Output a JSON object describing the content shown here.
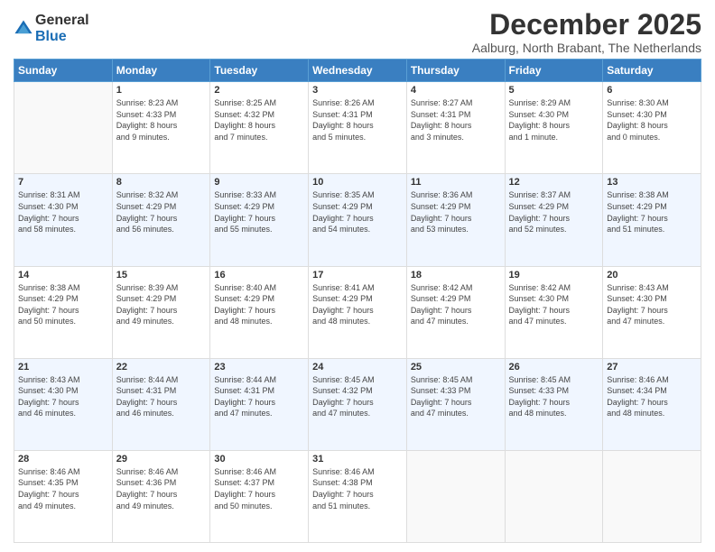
{
  "header": {
    "logo_general": "General",
    "logo_blue": "Blue",
    "month_title": "December 2025",
    "location": "Aalburg, North Brabant, The Netherlands"
  },
  "days_of_week": [
    "Sunday",
    "Monday",
    "Tuesday",
    "Wednesday",
    "Thursday",
    "Friday",
    "Saturday"
  ],
  "weeks": [
    [
      {
        "day": "",
        "info": ""
      },
      {
        "day": "1",
        "info": "Sunrise: 8:23 AM\nSunset: 4:33 PM\nDaylight: 8 hours\nand 9 minutes."
      },
      {
        "day": "2",
        "info": "Sunrise: 8:25 AM\nSunset: 4:32 PM\nDaylight: 8 hours\nand 7 minutes."
      },
      {
        "day": "3",
        "info": "Sunrise: 8:26 AM\nSunset: 4:31 PM\nDaylight: 8 hours\nand 5 minutes."
      },
      {
        "day": "4",
        "info": "Sunrise: 8:27 AM\nSunset: 4:31 PM\nDaylight: 8 hours\nand 3 minutes."
      },
      {
        "day": "5",
        "info": "Sunrise: 8:29 AM\nSunset: 4:30 PM\nDaylight: 8 hours\nand 1 minute."
      },
      {
        "day": "6",
        "info": "Sunrise: 8:30 AM\nSunset: 4:30 PM\nDaylight: 8 hours\nand 0 minutes."
      }
    ],
    [
      {
        "day": "7",
        "info": "Sunrise: 8:31 AM\nSunset: 4:30 PM\nDaylight: 7 hours\nand 58 minutes."
      },
      {
        "day": "8",
        "info": "Sunrise: 8:32 AM\nSunset: 4:29 PM\nDaylight: 7 hours\nand 56 minutes."
      },
      {
        "day": "9",
        "info": "Sunrise: 8:33 AM\nSunset: 4:29 PM\nDaylight: 7 hours\nand 55 minutes."
      },
      {
        "day": "10",
        "info": "Sunrise: 8:35 AM\nSunset: 4:29 PM\nDaylight: 7 hours\nand 54 minutes."
      },
      {
        "day": "11",
        "info": "Sunrise: 8:36 AM\nSunset: 4:29 PM\nDaylight: 7 hours\nand 53 minutes."
      },
      {
        "day": "12",
        "info": "Sunrise: 8:37 AM\nSunset: 4:29 PM\nDaylight: 7 hours\nand 52 minutes."
      },
      {
        "day": "13",
        "info": "Sunrise: 8:38 AM\nSunset: 4:29 PM\nDaylight: 7 hours\nand 51 minutes."
      }
    ],
    [
      {
        "day": "14",
        "info": "Sunrise: 8:38 AM\nSunset: 4:29 PM\nDaylight: 7 hours\nand 50 minutes."
      },
      {
        "day": "15",
        "info": "Sunrise: 8:39 AM\nSunset: 4:29 PM\nDaylight: 7 hours\nand 49 minutes."
      },
      {
        "day": "16",
        "info": "Sunrise: 8:40 AM\nSunset: 4:29 PM\nDaylight: 7 hours\nand 48 minutes."
      },
      {
        "day": "17",
        "info": "Sunrise: 8:41 AM\nSunset: 4:29 PM\nDaylight: 7 hours\nand 48 minutes."
      },
      {
        "day": "18",
        "info": "Sunrise: 8:42 AM\nSunset: 4:29 PM\nDaylight: 7 hours\nand 47 minutes."
      },
      {
        "day": "19",
        "info": "Sunrise: 8:42 AM\nSunset: 4:30 PM\nDaylight: 7 hours\nand 47 minutes."
      },
      {
        "day": "20",
        "info": "Sunrise: 8:43 AM\nSunset: 4:30 PM\nDaylight: 7 hours\nand 47 minutes."
      }
    ],
    [
      {
        "day": "21",
        "info": "Sunrise: 8:43 AM\nSunset: 4:30 PM\nDaylight: 7 hours\nand 46 minutes."
      },
      {
        "day": "22",
        "info": "Sunrise: 8:44 AM\nSunset: 4:31 PM\nDaylight: 7 hours\nand 46 minutes."
      },
      {
        "day": "23",
        "info": "Sunrise: 8:44 AM\nSunset: 4:31 PM\nDaylight: 7 hours\nand 47 minutes."
      },
      {
        "day": "24",
        "info": "Sunrise: 8:45 AM\nSunset: 4:32 PM\nDaylight: 7 hours\nand 47 minutes."
      },
      {
        "day": "25",
        "info": "Sunrise: 8:45 AM\nSunset: 4:33 PM\nDaylight: 7 hours\nand 47 minutes."
      },
      {
        "day": "26",
        "info": "Sunrise: 8:45 AM\nSunset: 4:33 PM\nDaylight: 7 hours\nand 48 minutes."
      },
      {
        "day": "27",
        "info": "Sunrise: 8:46 AM\nSunset: 4:34 PM\nDaylight: 7 hours\nand 48 minutes."
      }
    ],
    [
      {
        "day": "28",
        "info": "Sunrise: 8:46 AM\nSunset: 4:35 PM\nDaylight: 7 hours\nand 49 minutes."
      },
      {
        "day": "29",
        "info": "Sunrise: 8:46 AM\nSunset: 4:36 PM\nDaylight: 7 hours\nand 49 minutes."
      },
      {
        "day": "30",
        "info": "Sunrise: 8:46 AM\nSunset: 4:37 PM\nDaylight: 7 hours\nand 50 minutes."
      },
      {
        "day": "31",
        "info": "Sunrise: 8:46 AM\nSunset: 4:38 PM\nDaylight: 7 hours\nand 51 minutes."
      },
      {
        "day": "",
        "info": ""
      },
      {
        "day": "",
        "info": ""
      },
      {
        "day": "",
        "info": ""
      }
    ]
  ]
}
